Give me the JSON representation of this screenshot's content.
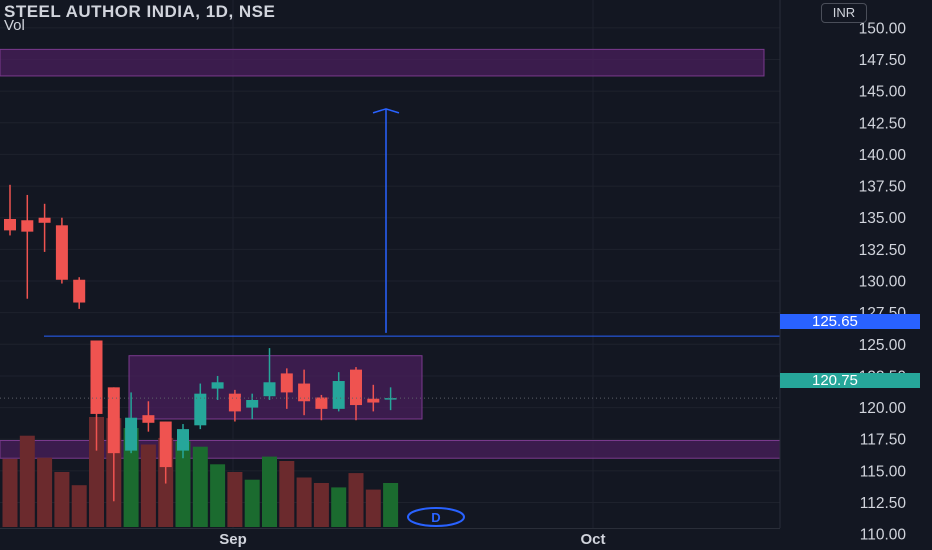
{
  "header": {
    "title": "STEEL AUTHOR INDIA, 1D, NSE",
    "volume_label": "Vol",
    "currency": "INR"
  },
  "price_tags": {
    "resistance": "125.65",
    "last": "120.75"
  },
  "event_marker": "D",
  "chart_data": {
    "type": "candlestick",
    "title": "STEEL AUTHOR INDIA, 1D, NSE",
    "ylim": [
      108.75,
      152.2
    ],
    "y_ticks": [
      110.0,
      112.5,
      115.0,
      117.5,
      120.0,
      122.5,
      125.0,
      127.5,
      130.0,
      132.5,
      135.0,
      137.5,
      140.0,
      142.5,
      145.0,
      147.5,
      150.0
    ],
    "x_ticks": [
      "Sep",
      "Oct"
    ],
    "grid": true,
    "colors": {
      "background": "#131722",
      "bull": "#26a69a",
      "bear": "#ef5350",
      "bull_volume": "#1b6b2f",
      "bear_volume": "#6b2a2d",
      "zone_fill": "#4a1f5c",
      "zone_border": "#7b3a8e",
      "horizontal_line": "#2962ff",
      "arrow": "#2962ff"
    },
    "candles": [
      {
        "o": 134.9,
        "h": 137.6,
        "l": 133.6,
        "c": 134.0
      },
      {
        "o": 134.8,
        "h": 136.8,
        "l": 128.6,
        "c": 133.9
      },
      {
        "o": 135.0,
        "h": 136.1,
        "l": 132.3,
        "c": 134.6
      },
      {
        "o": 134.4,
        "h": 135.0,
        "l": 129.8,
        "c": 130.1
      },
      {
        "o": 130.1,
        "h": 130.3,
        "l": 127.8,
        "c": 128.3
      },
      {
        "o": 125.3,
        "h": 125.3,
        "l": 116.6,
        "c": 119.5
      },
      {
        "o": 121.6,
        "h": 121.6,
        "l": 112.6,
        "c": 116.4
      },
      {
        "o": 116.6,
        "h": 121.2,
        "l": 116.4,
        "c": 119.2
      },
      {
        "o": 119.4,
        "h": 120.5,
        "l": 118.1,
        "c": 118.8
      },
      {
        "o": 118.9,
        "h": 118.9,
        "l": 114.0,
        "c": 115.3
      },
      {
        "o": 116.6,
        "h": 118.7,
        "l": 116.0,
        "c": 118.3
      },
      {
        "o": 118.6,
        "h": 121.9,
        "l": 118.3,
        "c": 121.1
      },
      {
        "o": 121.5,
        "h": 122.5,
        "l": 120.6,
        "c": 122.0
      },
      {
        "o": 121.1,
        "h": 121.4,
        "l": 118.9,
        "c": 119.7
      },
      {
        "o": 120.0,
        "h": 121.1,
        "l": 119.1,
        "c": 120.6
      },
      {
        "o": 120.9,
        "h": 124.7,
        "l": 120.6,
        "c": 122.0
      },
      {
        "o": 122.7,
        "h": 123.1,
        "l": 119.9,
        "c": 121.2
      },
      {
        "o": 121.9,
        "h": 123.0,
        "l": 119.4,
        "c": 120.5
      },
      {
        "o": 120.8,
        "h": 121.0,
        "l": 119.0,
        "c": 119.9
      },
      {
        "o": 119.9,
        "h": 122.8,
        "l": 119.7,
        "c": 122.1
      },
      {
        "o": 123.0,
        "h": 123.2,
        "l": 119.0,
        "c": 120.2
      },
      {
        "o": 120.7,
        "h": 121.8,
        "l": 119.7,
        "c": 120.4
      },
      {
        "o": 120.7,
        "h": 121.6,
        "l": 119.8,
        "c": 120.75
      }
    ],
    "volume_relative": [
      0.62,
      0.83,
      0.63,
      0.5,
      0.38,
      1.0,
      0.99,
      0.9,
      0.75,
      0.81,
      0.78,
      0.73,
      0.57,
      0.5,
      0.43,
      0.64,
      0.6,
      0.45,
      0.4,
      0.36,
      0.49,
      0.34,
      0.4
    ],
    "zones": [
      {
        "from": 146.2,
        "to": 148.3
      },
      {
        "from": 116.0,
        "to": 117.4
      },
      {
        "from": 119.1,
        "to": 124.1
      }
    ],
    "horizontal_line": 125.65,
    "arrow": {
      "from": 125.9,
      "to": 143.6
    }
  }
}
